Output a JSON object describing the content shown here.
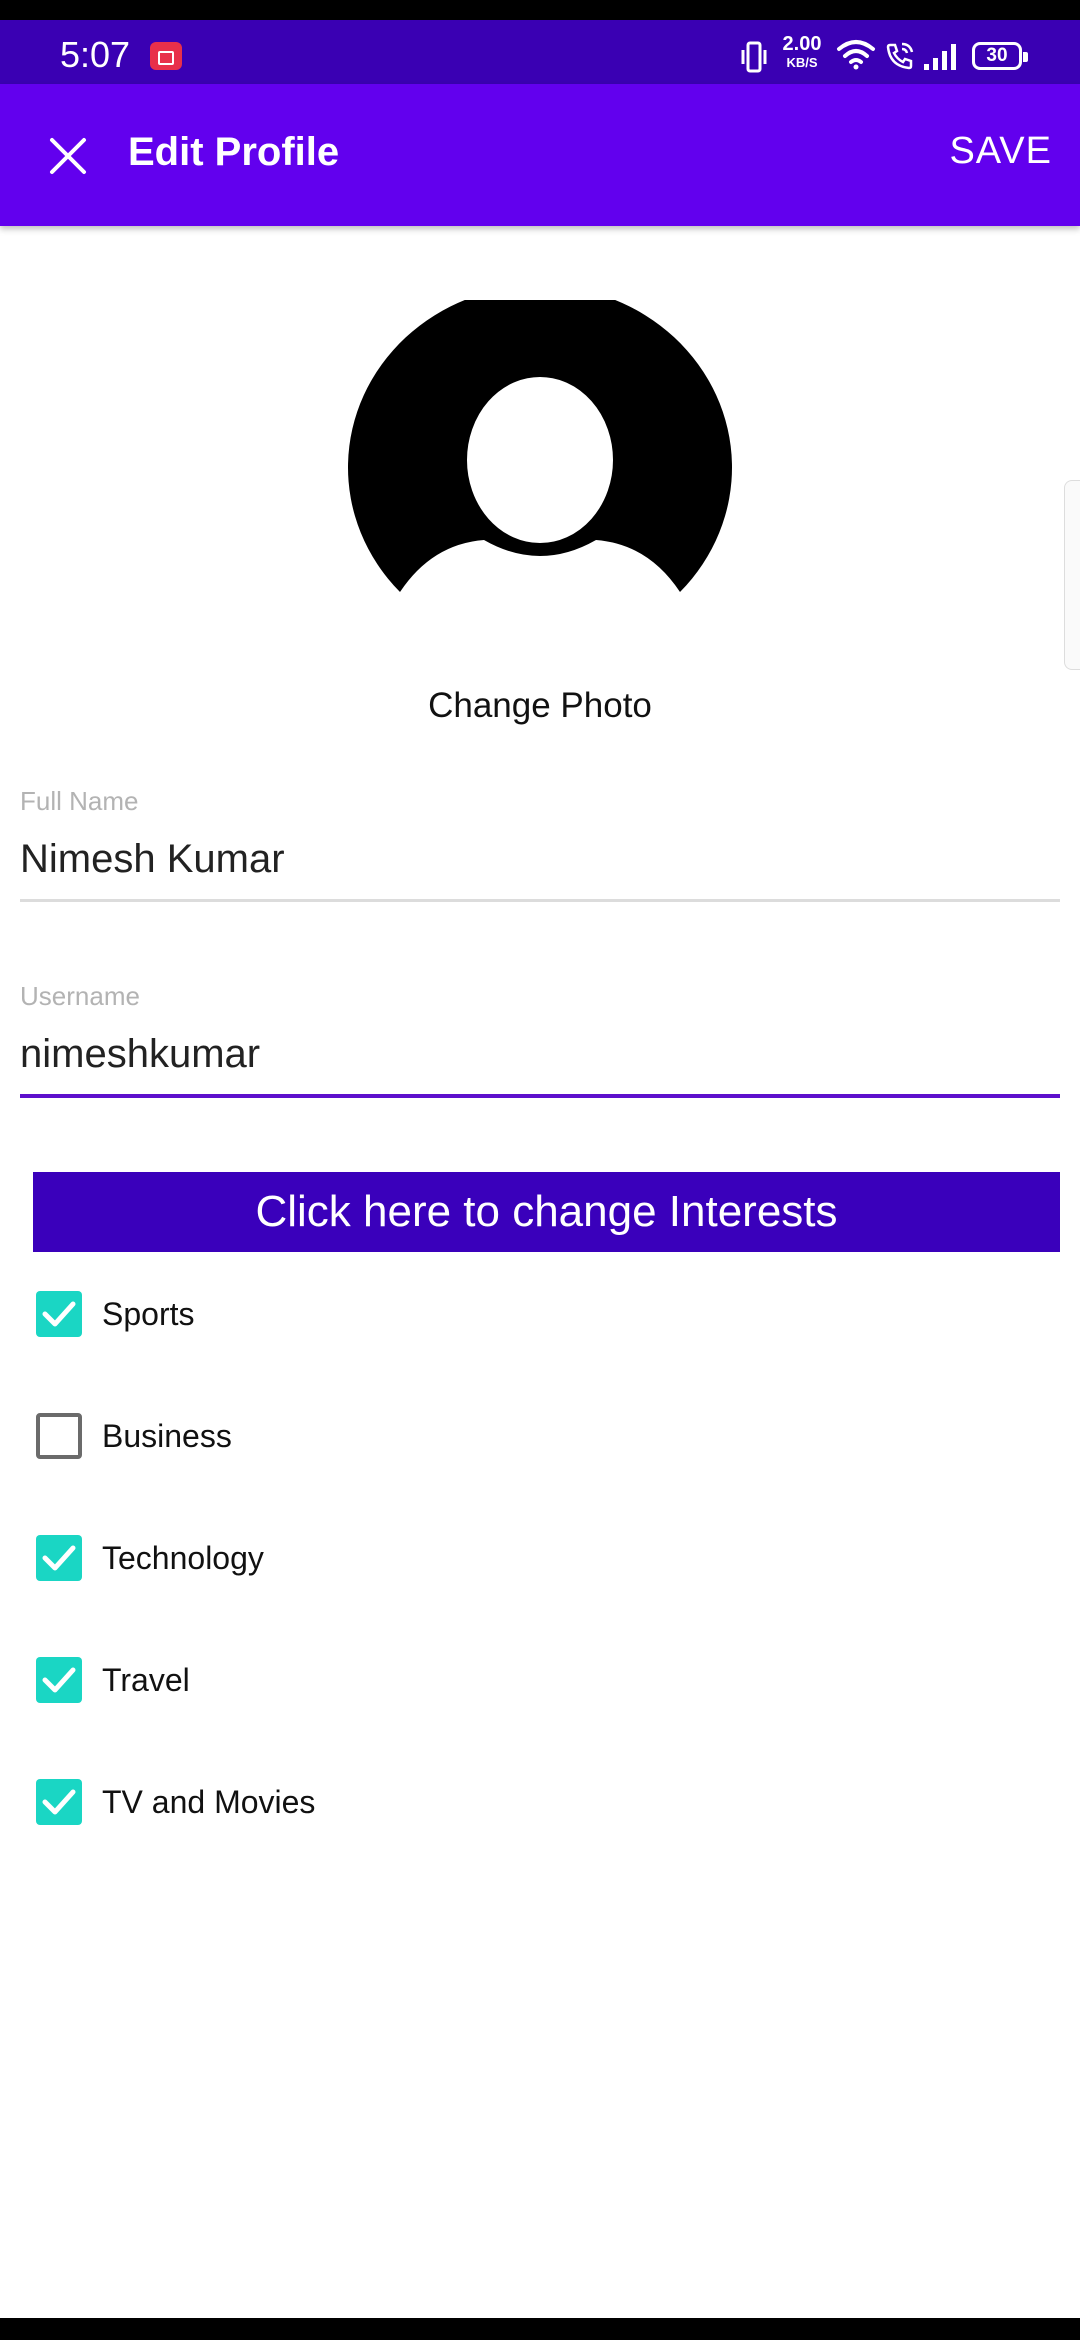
{
  "status_bar": {
    "time": "5:07",
    "net_speed_value": "2.00",
    "net_speed_unit": "KB/S",
    "battery": "30",
    "icons": [
      "screen-record-icon",
      "vibrate-icon",
      "wifi-icon",
      "wifi-call-icon",
      "signal-icon",
      "battery-icon"
    ]
  },
  "app_bar": {
    "title": "Edit Profile",
    "save_label": "SAVE",
    "close_icon": "close-icon",
    "background": "#6200ee"
  },
  "profile": {
    "avatar_icon": "default-avatar-icon",
    "change_photo_label": "Change Photo"
  },
  "form": {
    "full_name": {
      "label": "Full Name",
      "value": "Nimesh Kumar"
    },
    "username": {
      "label": "Username",
      "value": "nimeshkumar"
    }
  },
  "interests": {
    "button_label": "Click here to change Interests",
    "button_color": "#3a00bb",
    "check_color": "#1ad6c4",
    "items": [
      {
        "label": "Sports",
        "checked": true
      },
      {
        "label": "Business",
        "checked": false
      },
      {
        "label": "Technology",
        "checked": true
      },
      {
        "label": "Travel",
        "checked": true
      },
      {
        "label": "TV and Movies",
        "checked": true
      }
    ]
  }
}
